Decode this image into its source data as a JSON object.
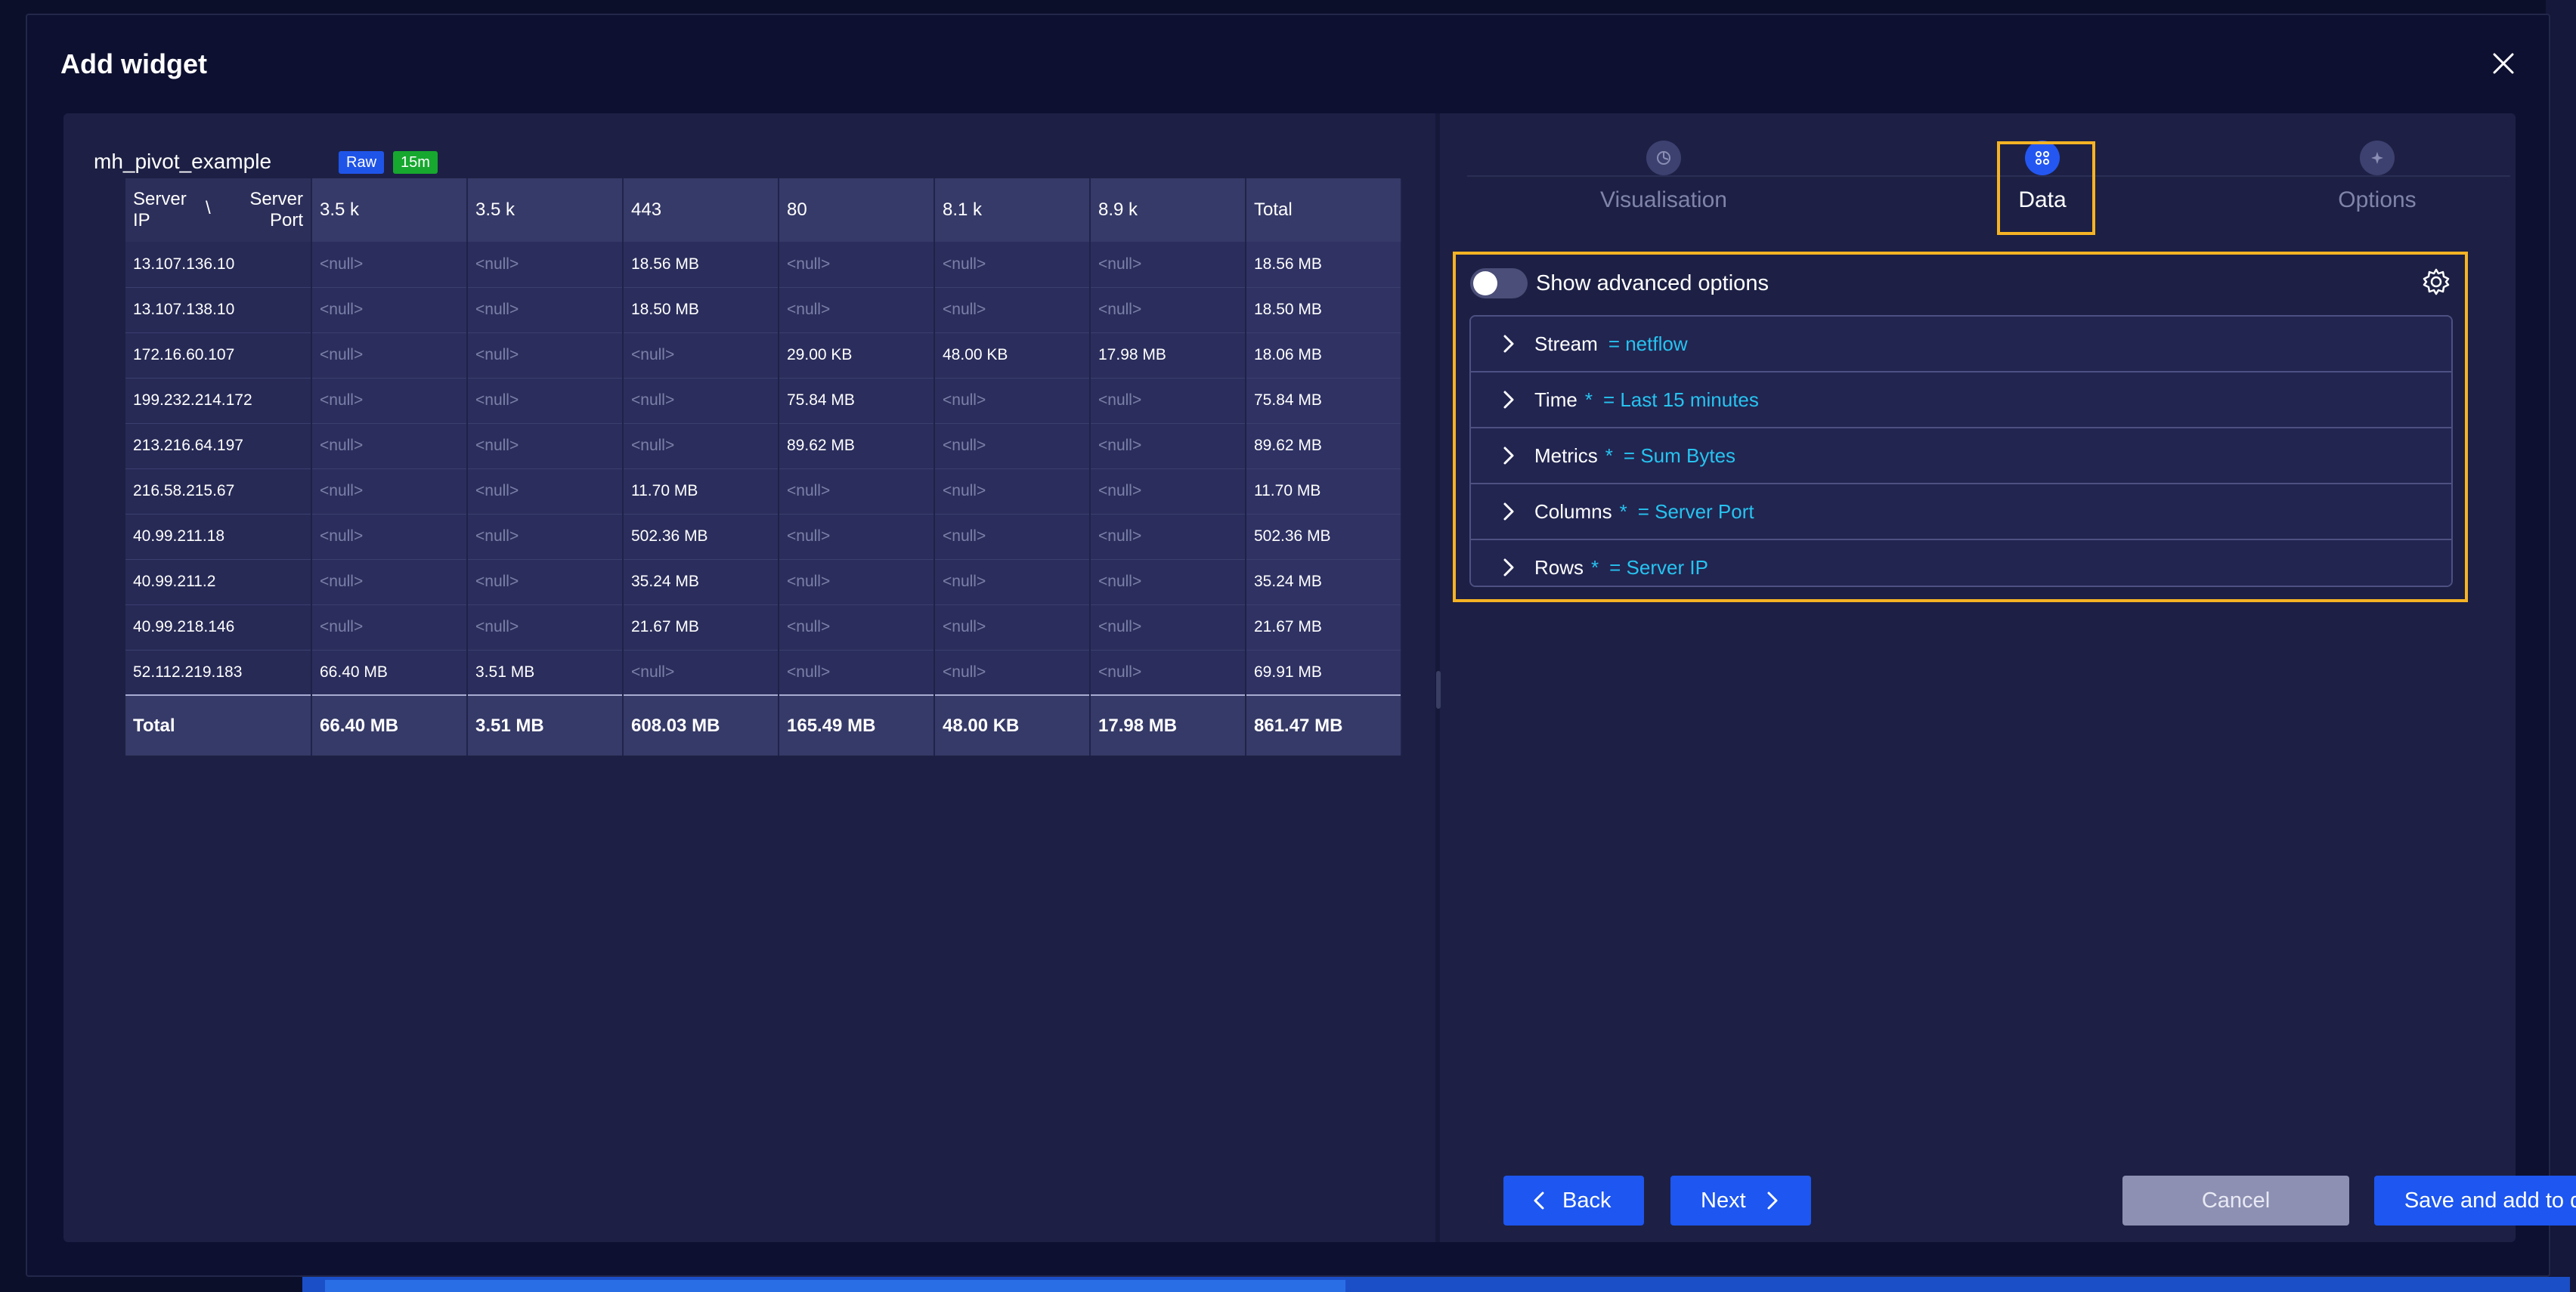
{
  "dialog": {
    "title": "Add widget"
  },
  "preview": {
    "stream_name": "mh_pivot_example",
    "badges": {
      "raw": "Raw",
      "duration": "15m"
    },
    "corner": {
      "row_dim_line1": "Server",
      "row_dim_line2": "IP",
      "separator": "\\",
      "col_dim_line1": "Server",
      "col_dim_line2": "Port"
    },
    "columns": [
      "3.5 k",
      "3.5 k",
      "443",
      "80",
      "8.1 k",
      "8.9 k",
      "Total"
    ],
    "rows": [
      {
        "ip": "13.107.136.10",
        "cells": [
          "<null>",
          "<null>",
          "18.56 MB",
          "<null>",
          "<null>",
          "<null>",
          "18.56 MB"
        ]
      },
      {
        "ip": "13.107.138.10",
        "cells": [
          "<null>",
          "<null>",
          "18.50 MB",
          "<null>",
          "<null>",
          "<null>",
          "18.50 MB"
        ]
      },
      {
        "ip": "172.16.60.107",
        "cells": [
          "<null>",
          "<null>",
          "<null>",
          "29.00 KB",
          "48.00 KB",
          "17.98 MB",
          "18.06 MB"
        ]
      },
      {
        "ip": "199.232.214.172",
        "cells": [
          "<null>",
          "<null>",
          "<null>",
          "75.84 MB",
          "<null>",
          "<null>",
          "75.84 MB"
        ]
      },
      {
        "ip": "213.216.64.197",
        "cells": [
          "<null>",
          "<null>",
          "<null>",
          "89.62 MB",
          "<null>",
          "<null>",
          "89.62 MB"
        ]
      },
      {
        "ip": "216.58.215.67",
        "cells": [
          "<null>",
          "<null>",
          "11.70 MB",
          "<null>",
          "<null>",
          "<null>",
          "11.70 MB"
        ]
      },
      {
        "ip": "40.99.211.18",
        "cells": [
          "<null>",
          "<null>",
          "502.36 MB",
          "<null>",
          "<null>",
          "<null>",
          "502.36 MB"
        ]
      },
      {
        "ip": "40.99.211.2",
        "cells": [
          "<null>",
          "<null>",
          "35.24 MB",
          "<null>",
          "<null>",
          "<null>",
          "35.24 MB"
        ]
      },
      {
        "ip": "40.99.218.146",
        "cells": [
          "<null>",
          "<null>",
          "21.67 MB",
          "<null>",
          "<null>",
          "<null>",
          "21.67 MB"
        ]
      },
      {
        "ip": "52.112.219.183",
        "cells": [
          "66.40 MB",
          "3.51 MB",
          "<null>",
          "<null>",
          "<null>",
          "<null>",
          "69.91 MB"
        ]
      }
    ],
    "totals": {
      "label": "Total",
      "cells": [
        "66.40 MB",
        "3.51 MB",
        "608.03 MB",
        "165.49 MB",
        "48.00 KB",
        "17.98 MB",
        "861.47 MB"
      ]
    }
  },
  "wizard": {
    "steps": [
      {
        "label": "Visualisation",
        "icon": "chart-icon",
        "active": false
      },
      {
        "label": "Data",
        "icon": "data-icon",
        "active": true
      },
      {
        "label": "Options",
        "icon": "sparkle-icon",
        "active": false
      }
    ]
  },
  "data_config": {
    "advanced_toggle_label": "Show advanced options",
    "advanced_toggle_on": false,
    "sections": [
      {
        "name": "Stream",
        "required": false,
        "value": "= netflow"
      },
      {
        "name": "Time",
        "required": true,
        "value": "= Last 15 minutes"
      },
      {
        "name": "Metrics",
        "required": true,
        "value": "= Sum Bytes"
      },
      {
        "name": "Columns",
        "required": true,
        "value": "= Server Port"
      },
      {
        "name": "Rows",
        "required": true,
        "value": "= Server IP"
      }
    ],
    "required_marker": "*"
  },
  "footer": {
    "back_label": "Back",
    "next_label": "Next",
    "cancel_label": "Cancel",
    "save_label": "Save and add to dashboard"
  },
  "colors": {
    "accent": "#1d56f0",
    "highlight": "#f5b324",
    "value_text": "#27c3f0",
    "badge_raw": "#1f54e8",
    "badge_duration": "#17a82f"
  }
}
